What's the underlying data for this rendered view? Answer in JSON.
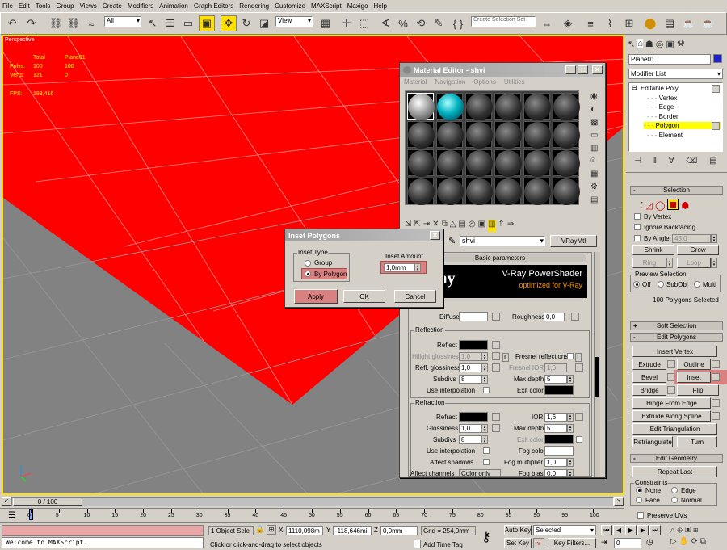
{
  "menu": [
    "File",
    "Edit",
    "Tools",
    "Group",
    "Views",
    "Create",
    "Modifiers",
    "Animation",
    "Graph Editors",
    "Rendering",
    "Customize",
    "MAXScript",
    "Maxigo",
    "Help"
  ],
  "toolbar": {
    "filter": "All",
    "view": "View",
    "selection_set": "Create Selection Set"
  },
  "viewport": {
    "label": "Perspective",
    "stats_total": "Total",
    "stats_obj": "Plane01",
    "polys_label": "Polys:",
    "polys_total": "100",
    "polys_obj": "100",
    "verts_label": "Verts:",
    "verts_total": "121",
    "verts_obj": "0",
    "fps_label": "FPS:",
    "fps": "193,416"
  },
  "material_editor": {
    "title": "Material Editor - shvi",
    "menu": [
      "Material",
      "Navigation",
      "Options",
      "Utilities"
    ],
    "mat_name": "shvi",
    "mat_type": "VRayMtl",
    "basic_params": "Basic parameters",
    "vray_logo": "v-ray",
    "banner1": "V-Ray PowerShader",
    "banner2": "optimized for V-Ray",
    "diffuse": "Diffuse",
    "roughness": "Roughness",
    "roughness_val": "0,0",
    "reflection": "Reflection",
    "reflect": "Reflect",
    "hilight": "Hilight glossiness",
    "hilight_val": "1,0",
    "L": "L",
    "fresnel": "Fresnel reflections",
    "refl_gloss": "Refl. glossiness",
    "refl_gloss_val": "1,0",
    "fresnel_ior": "Fresnel IOR",
    "fresnel_ior_val": "1,6",
    "subdivs": "Subdivs",
    "subdivs_val": "8",
    "max_depth": "Max depth",
    "max_depth_val": "5",
    "use_interp": "Use interpolation",
    "exit_color": "Exit color",
    "refraction": "Refraction",
    "refract": "Refract",
    "ior": "IOR",
    "ior_val": "1,6",
    "glossiness": "Glossiness",
    "gloss_val": "1,0",
    "max_depth2_val": "5",
    "exit_color2": "Exit color",
    "subdivs2_val": "8",
    "fog_color": "Fog color",
    "use_interp2": "Use interpolation",
    "affect_shadows": "Affect shadows",
    "fog_mult": "Fog multiplier",
    "fog_mult_val": "1,0",
    "affect_channels": "Affect channels",
    "affect_channels_val": "Color only",
    "fog_bias": "Fog bias",
    "fog_bias_val": "0,0"
  },
  "inset_dialog": {
    "title": "Inset Polygons",
    "type_label": "Inset Type",
    "group": "Group",
    "by_polygon": "By Polygon",
    "amount_label": "Inset Amount",
    "amount": "1,0mm",
    "apply": "Apply",
    "ok": "OK",
    "cancel": "Cancel"
  },
  "panel": {
    "object_name": "Plane01",
    "modifier_list": "Modifier List",
    "stack": [
      "Editable Poly",
      "Vertex",
      "Edge",
      "Border",
      "Polygon",
      "Element"
    ],
    "selection": "Selection",
    "by_vertex": "By Vertex",
    "ignore_backfacing": "Ignore Backfacing",
    "by_angle": "By Angle:",
    "angle_val": "45,0",
    "shrink": "Shrink",
    "grow": "Grow",
    "ring": "Ring",
    "loop": "Loop",
    "preview": "Preview Selection",
    "off": "Off",
    "subobj": "SubObj",
    "multi": "Multi",
    "sel_count": "100 Polygons Selected",
    "soft_selection": "Soft Selection",
    "edit_polygons": "Edit Polygons",
    "insert_vertex": "Insert Vertex",
    "extrude": "Extrude",
    "outline": "Outline",
    "bevel": "Bevel",
    "inset": "Inset",
    "bridge": "Bridge",
    "flip": "Flip",
    "hinge": "Hinge From Edge",
    "extrude_spline": "Extrude Along Spline",
    "edit_tri": "Edit Triangulation",
    "retriangulate": "Retriangulate",
    "turn": "Turn",
    "edit_geometry": "Edit Geometry",
    "repeat_last": "Repeat Last",
    "constraints": "Constraints",
    "none": "None",
    "edge": "Edge",
    "face": "Face",
    "normal": "Normal",
    "preserve_uvs": "Preserve UVs"
  },
  "timeline": {
    "slider": "0 / 100",
    "ticks": [
      "0",
      "5",
      "10",
      "15",
      "20",
      "25",
      "30",
      "35",
      "40",
      "45",
      "50",
      "55",
      "60",
      "65",
      "70",
      "75",
      "80",
      "85",
      "90",
      "95",
      "100"
    ]
  },
  "status": {
    "maxscript": "Welcome to MAXScript.",
    "objects": "1 Object Sele",
    "x_val": "1110,098m",
    "y_val": "-118,646mi",
    "z_val": "0,0mm",
    "grid": "Grid = 254,0mm",
    "auto_key": "Auto Key",
    "selected": "Selected",
    "set_key": "Set Key",
    "key_filters": "Key Filters...",
    "prompt": "Click or click-and-drag to select objects",
    "add_time_tag": "Add Time Tag",
    "frame": "0"
  },
  "colors": {
    "viewport_red": "#ff0000",
    "accent_yellow": "#ffe000",
    "inset_highlight": "#d98080"
  }
}
